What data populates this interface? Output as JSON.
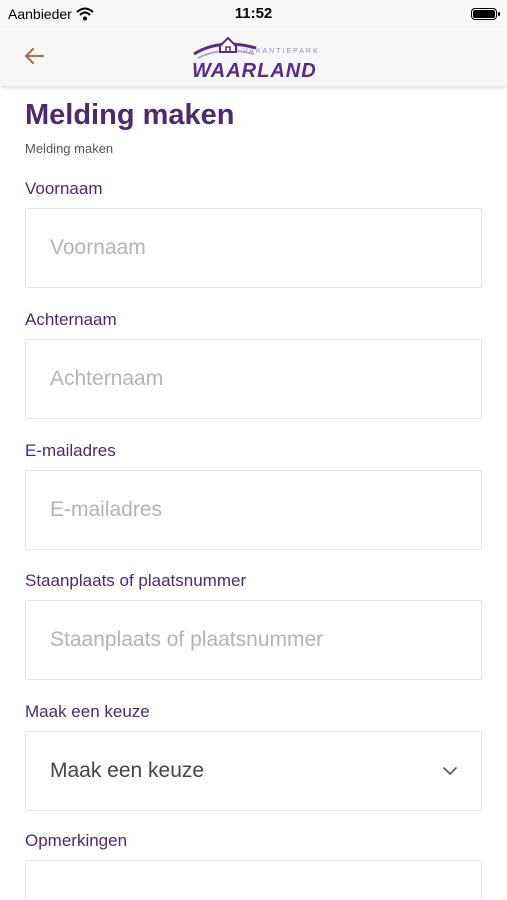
{
  "status_bar": {
    "carrier": "Aanbieder",
    "time": "11:52"
  },
  "header": {
    "back_icon": "arrow-left-icon",
    "logo_small_text": "VAKANTIEPARK",
    "logo_main_text": "WAARLAND"
  },
  "page": {
    "title": "Melding maken",
    "breadcrumb": "Melding maken"
  },
  "form": {
    "first_name": {
      "label": "Voornaam",
      "placeholder": "Voornaam"
    },
    "last_name": {
      "label": "Achternaam",
      "placeholder": "Achternaam"
    },
    "email": {
      "label": "E-mailadres",
      "placeholder": "E-mailadres"
    },
    "pitch": {
      "label": "Staanplaats of plaatsnummer",
      "placeholder": "Staanplaats of plaatsnummer"
    },
    "choice": {
      "label": "Maak een keuze",
      "value": "Maak een keuze"
    },
    "remarks": {
      "label": "Opmerkingen"
    }
  },
  "colors": {
    "accent": "#4b2a6e",
    "logo": "#5b2a86",
    "back_arrow": "#a0785e"
  }
}
